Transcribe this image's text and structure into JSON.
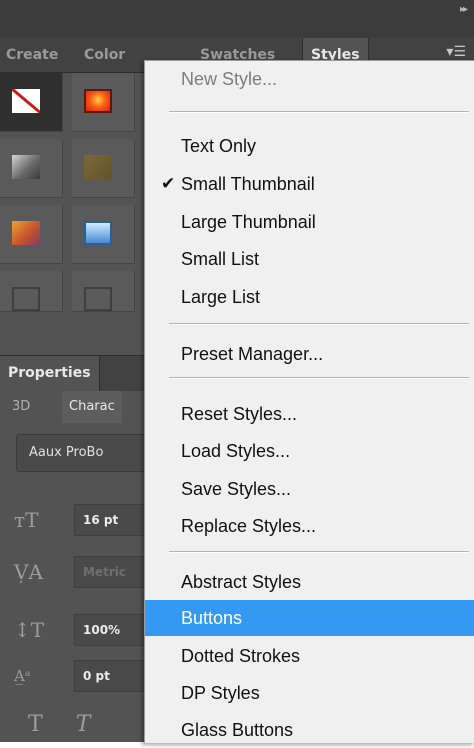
{
  "styles_panel": {
    "tabs": [
      "Create",
      "Color",
      "Swatches",
      "Styles"
    ],
    "active_tab": "Styles",
    "menu_button_icon": "panel-menu-icon",
    "collapse_icon": "double-arrow-icon"
  },
  "style_thumbnails": [
    {
      "icon": "no-style-swatch",
      "color": "#ffffff",
      "selected": true
    },
    {
      "icon": "red-glow-swatch",
      "color": "#ff5a14"
    },
    {
      "icon": "grey-gradient-swatch",
      "color": "#8a8a8a"
    },
    {
      "icon": "brown-swatch",
      "color": "#6e5d30"
    },
    {
      "icon": "orange-gradient-swatch",
      "color": "#d9743a"
    },
    {
      "icon": "blue-glass-swatch",
      "color": "#8fc3f0"
    },
    {
      "icon": "empty-swatch"
    },
    {
      "icon": "empty-swatch"
    }
  ],
  "properties_panel": {
    "title": "Properties",
    "subtabs": [
      "3D",
      "Charac"
    ],
    "font_family": "Aaux ProBo",
    "font_size": "16 pt",
    "kerning": "Metric",
    "vertical_scale": "100%",
    "baseline_shift": "0 pt",
    "icons": [
      "font-size-icon",
      "kerning-icon",
      "vertical-scale-icon",
      "baseline-shift-icon",
      "faux-bold-icon",
      "faux-italic-icon"
    ]
  },
  "context_menu": {
    "items": [
      {
        "label": "New Style...",
        "disabled": true
      },
      {
        "label": "Text Only"
      },
      {
        "label": "Small Thumbnail",
        "checked": true
      },
      {
        "label": "Large Thumbnail"
      },
      {
        "label": "Small List"
      },
      {
        "label": "Large List"
      },
      {
        "label": "Preset Manager..."
      },
      {
        "label": "Reset Styles..."
      },
      {
        "label": "Load Styles..."
      },
      {
        "label": "Save Styles..."
      },
      {
        "label": "Replace Styles..."
      },
      {
        "label": "Abstract Styles"
      },
      {
        "label": "Buttons",
        "highlighted": true
      },
      {
        "label": "Dotted Strokes"
      },
      {
        "label": "DP Styles"
      },
      {
        "label": "Glass Buttons"
      }
    ],
    "checkmark": "✔",
    "highlight_color": "#3399f3"
  }
}
